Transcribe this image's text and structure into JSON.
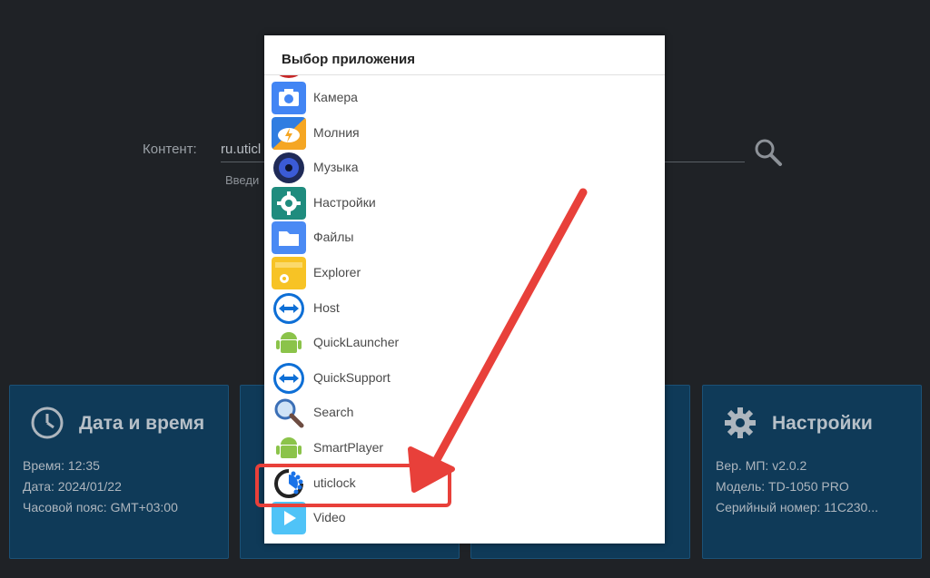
{
  "background": {
    "content_label": "Контент:",
    "content_value": "ru.uticl",
    "content_hint": "Введи"
  },
  "cards": [
    {
      "title": "Дата и время",
      "lines": [
        "Время: 12:35",
        "Дата: 2024/01/22",
        "Часовой пояс: GMT+03:00"
      ]
    },
    {
      "title": "Настройки",
      "lines": [
        "Вер. МП: v2.0.2",
        "Модель: TD-1050 PRO",
        "Серийный номер: 11C230..."
      ]
    }
  ],
  "dialog": {
    "title": "Выбор приложения",
    "items": [
      {
        "label": "Камера",
        "icon": "camera-icon",
        "color": "#4285f4"
      },
      {
        "label": "Молния",
        "icon": "lightning-cloud-icon",
        "color": "#2f7de1"
      },
      {
        "label": "Музыка",
        "icon": "speaker-icon",
        "color": "#1f2a57"
      },
      {
        "label": "Настройки",
        "icon": "gear-icon",
        "color": "#1f8c7e"
      },
      {
        "label": "Файлы",
        "icon": "folder-icon",
        "color": "#4a8af4"
      },
      {
        "label": "Explorer",
        "icon": "explorer-folder-icon",
        "color": "#f7c325"
      },
      {
        "label": "Host",
        "icon": "teamviewer-host-icon",
        "color": "#0e6fd6"
      },
      {
        "label": "QuickLauncher",
        "icon": "android-robot-icon",
        "color": "#8bc34a"
      },
      {
        "label": "QuickSupport",
        "icon": "teamviewer-qs-icon",
        "color": "#0e6fd6"
      },
      {
        "label": "Search",
        "icon": "magnifier-icon",
        "color": "#3b6fb6"
      },
      {
        "label": "SmartPlayer",
        "icon": "android-robot-icon",
        "color": "#8bc34a"
      },
      {
        "label": "uticlock",
        "icon": "uticlock-icon",
        "color": "#1a73e8"
      },
      {
        "label": "Video",
        "icon": "play-icon",
        "color": "#4fc3f7"
      }
    ]
  },
  "accent": "#e8403a"
}
